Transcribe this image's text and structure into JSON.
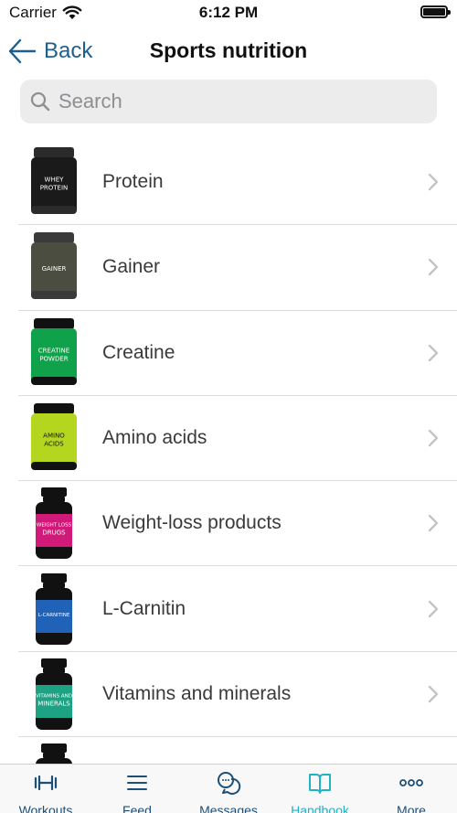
{
  "status_bar": {
    "carrier": "Carrier",
    "time": "6:12 PM"
  },
  "nav": {
    "back_label": "Back",
    "title": "Sports nutrition"
  },
  "search": {
    "placeholder": "Search"
  },
  "items": [
    {
      "label": "Protein",
      "jar_color": "#1a1a1a",
      "lid_color": "#2b2b2b",
      "jar_text": "WHEY PROTEIN",
      "shape": "tub"
    },
    {
      "label": "Gainer",
      "jar_color": "#4a4d40",
      "lid_color": "#3a3a3a",
      "jar_text": "GAINER",
      "shape": "tub"
    },
    {
      "label": "Creatine",
      "jar_color": "#0fa24a",
      "lid_color": "#111111",
      "jar_text": "CREATINE POWDER",
      "shape": "tub"
    },
    {
      "label": "Amino acids",
      "jar_color": "#b5d61e",
      "lid_color": "#111111",
      "jar_text": "AMINO ACIDS",
      "shape": "tub"
    },
    {
      "label": "Weight-loss products",
      "jar_color": "#d1197a",
      "lid_color": "#111111",
      "jar_text": "WEIGHT LOSS DRUGS",
      "shape": "bottle"
    },
    {
      "label": "L-Carnitin",
      "jar_color": "#1f62b8",
      "lid_color": "#111111",
      "jar_text": "L-CARNITINE",
      "shape": "bottle"
    },
    {
      "label": "Vitamins and minerals",
      "jar_color": "#1ea284",
      "lid_color": "#111111",
      "jar_text": "VITAMINS AND MINERALS",
      "shape": "bottle"
    },
    {
      "label": "",
      "jar_color": "#111111",
      "lid_color": "#111111",
      "jar_text": "",
      "shape": "bottle"
    }
  ],
  "tabs": [
    {
      "label": "Workouts",
      "icon": "dumbbell-icon",
      "active": false
    },
    {
      "label": "Feed",
      "icon": "feed-lines-icon",
      "active": false
    },
    {
      "label": "Messages",
      "icon": "chat-bubbles-icon",
      "active": false
    },
    {
      "label": "Handbook",
      "icon": "open-book-icon",
      "active": true
    },
    {
      "label": "More",
      "icon": "more-dots-icon",
      "active": false
    }
  ],
  "colors": {
    "accent": "#1fb3c4",
    "nav_blue": "#1d5f8e",
    "tab_inactive": "#1d4f78"
  }
}
